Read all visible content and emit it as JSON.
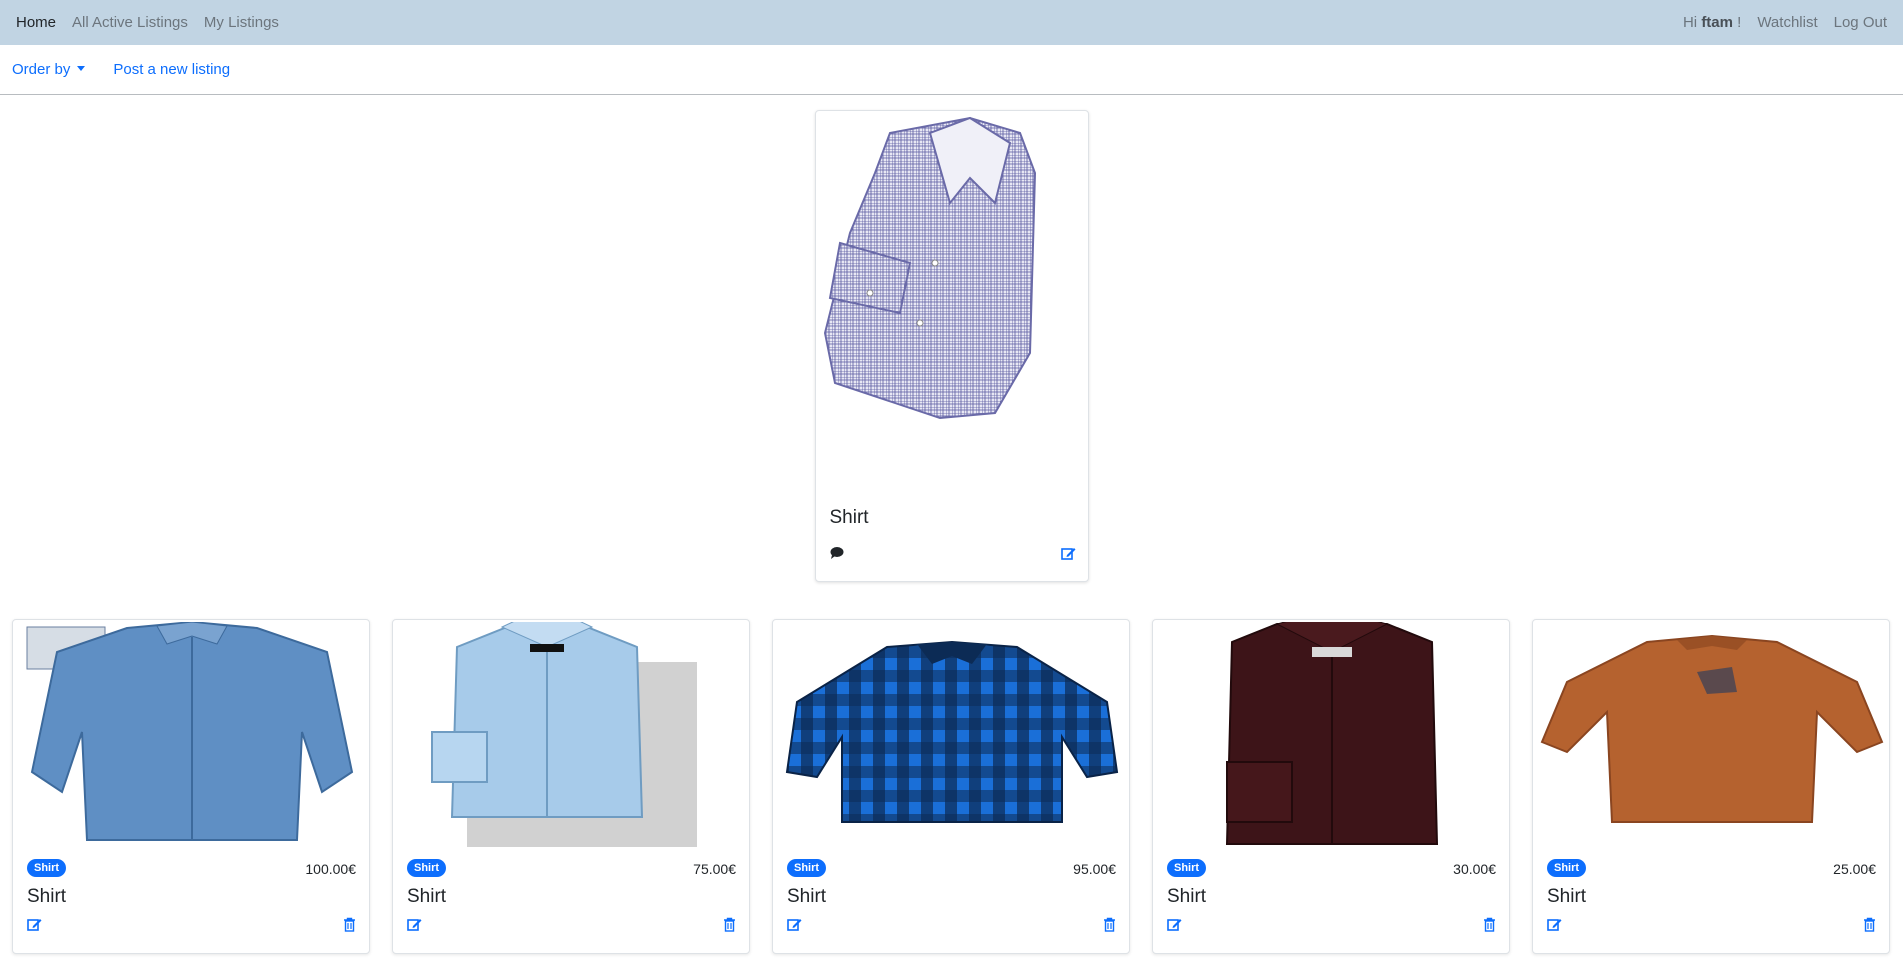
{
  "nav": {
    "home": "Home",
    "all_active": "All Active Listings",
    "my_listings": "My Listings",
    "hi": "Hi",
    "username": "ftam",
    "exclaim": "!",
    "watchlist": "Watchlist",
    "logout": "Log Out"
  },
  "subnav": {
    "order_by": "Order by",
    "post_new": "Post a new listing"
  },
  "featured": {
    "title": "Shirt",
    "icons": [
      "comment-icon",
      "edit-icon"
    ]
  },
  "listings": [
    {
      "category": "Shirt",
      "price": "100.00€",
      "title": "Shirt"
    },
    {
      "category": "Shirt",
      "price": "75.00€",
      "title": "Shirt"
    },
    {
      "category": "Shirt",
      "price": "95.00€",
      "title": "Shirt"
    },
    {
      "category": "Shirt",
      "price": "30.00€",
      "title": "Shirt"
    },
    {
      "category": "Shirt",
      "price": "25.00€",
      "title": "Shirt"
    }
  ],
  "colors": {
    "navbar": "#c1d4e3",
    "accent": "#0d6efd"
  }
}
